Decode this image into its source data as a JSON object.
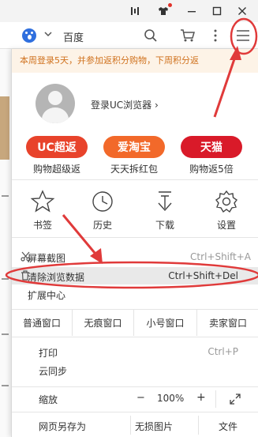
{
  "browser": {
    "search_engine": "百度",
    "icons": {
      "vertical_bars": "vertical-bars-icon",
      "shirt": "shirt-icon",
      "minimize": "minimize-icon",
      "maximize": "maximize-icon",
      "close": "close-icon",
      "search": "search-icon",
      "cart": "cart-icon",
      "more": "more-dots-icon",
      "menu": "hamburger-menu-icon"
    }
  },
  "menu": {
    "notice": "本周登录5天，并参加返积分购物，下周积分返",
    "login_text": "登录UC浏览器 ›",
    "promos": [
      {
        "badge": "UC超返",
        "caption": "购物超级返",
        "color": "#e8432b"
      },
      {
        "badge": "爱淘宝",
        "caption": "天天拆红包",
        "color": "#f2692a"
      },
      {
        "badge": "天猫",
        "caption": "购物返5倍",
        "color": "#d91a29"
      }
    ],
    "quick": [
      {
        "label": "书签",
        "icon": "star-icon"
      },
      {
        "label": "历史",
        "icon": "clock-icon"
      },
      {
        "label": "下载",
        "icon": "download-icon"
      },
      {
        "label": "设置",
        "icon": "gear-icon"
      }
    ],
    "screenshot": {
      "label": "屏幕截图",
      "shortcut": "Ctrl+Shift+A"
    },
    "clear_data": {
      "label": "清除浏览数据",
      "shortcut": "Ctrl+Shift+Del"
    },
    "extensions": "扩展中心",
    "window_buttons": [
      "普通窗口",
      "无痕窗口",
      "小号窗口",
      "卖家窗口"
    ],
    "print": {
      "label": "打印",
      "shortcut": "Ctrl+P"
    },
    "cloud_sync": "云同步",
    "zoom": {
      "label": "缩放",
      "minus": "−",
      "value": "100%",
      "plus": "+"
    },
    "save_as": "网页另存为",
    "lossless": "无损图片",
    "file": "文件"
  },
  "annotation_color": "#e03a3a"
}
